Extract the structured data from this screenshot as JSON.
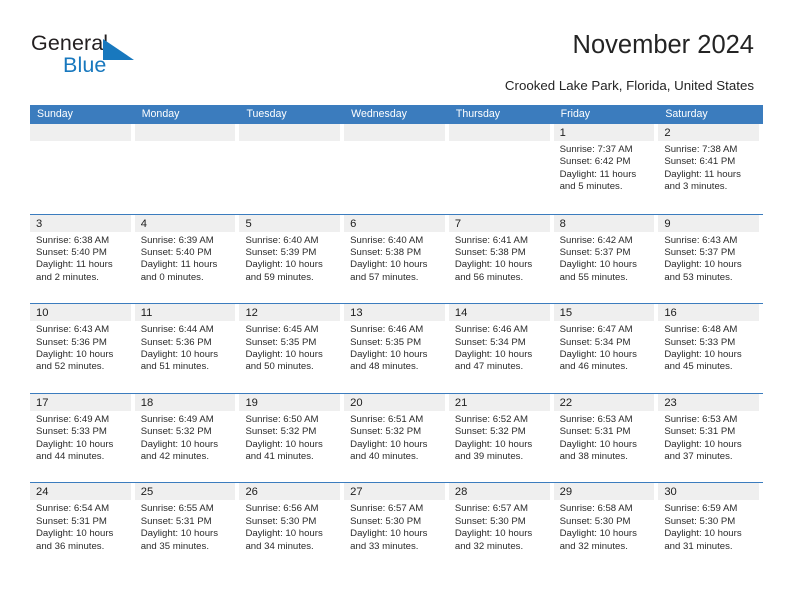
{
  "brand": {
    "name_part1": "General",
    "name_part2": "Blue",
    "accent_color": "#1878be",
    "triangle_icon": "blue-triangle-logo-mark"
  },
  "header": {
    "title": "November 2024",
    "subtitle": "Crooked Lake Park, Florida, United States"
  },
  "calendar": {
    "header_bg": "#3b7cbe",
    "datebar_bg": "#efefef",
    "weekday_headers": [
      "Sunday",
      "Monday",
      "Tuesday",
      "Wednesday",
      "Thursday",
      "Friday",
      "Saturday"
    ],
    "weeks": [
      [
        {
          "day": "",
          "empty": true,
          "lines": []
        },
        {
          "day": "",
          "empty": true,
          "lines": []
        },
        {
          "day": "",
          "empty": true,
          "lines": []
        },
        {
          "day": "",
          "empty": true,
          "lines": []
        },
        {
          "day": "",
          "empty": true,
          "lines": []
        },
        {
          "day": "1",
          "empty": false,
          "lines": [
            "Sunrise: 7:37 AM",
            "Sunset: 6:42 PM",
            "Daylight: 11 hours",
            "and 5 minutes."
          ]
        },
        {
          "day": "2",
          "empty": false,
          "lines": [
            "Sunrise: 7:38 AM",
            "Sunset: 6:41 PM",
            "Daylight: 11 hours",
            "and 3 minutes."
          ]
        }
      ],
      [
        {
          "day": "3",
          "empty": false,
          "lines": [
            "Sunrise: 6:38 AM",
            "Sunset: 5:40 PM",
            "Daylight: 11 hours",
            "and 2 minutes."
          ]
        },
        {
          "day": "4",
          "empty": false,
          "lines": [
            "Sunrise: 6:39 AM",
            "Sunset: 5:40 PM",
            "Daylight: 11 hours",
            "and 0 minutes."
          ]
        },
        {
          "day": "5",
          "empty": false,
          "lines": [
            "Sunrise: 6:40 AM",
            "Sunset: 5:39 PM",
            "Daylight: 10 hours",
            "and 59 minutes."
          ]
        },
        {
          "day": "6",
          "empty": false,
          "lines": [
            "Sunrise: 6:40 AM",
            "Sunset: 5:38 PM",
            "Daylight: 10 hours",
            "and 57 minutes."
          ]
        },
        {
          "day": "7",
          "empty": false,
          "lines": [
            "Sunrise: 6:41 AM",
            "Sunset: 5:38 PM",
            "Daylight: 10 hours",
            "and 56 minutes."
          ]
        },
        {
          "day": "8",
          "empty": false,
          "lines": [
            "Sunrise: 6:42 AM",
            "Sunset: 5:37 PM",
            "Daylight: 10 hours",
            "and 55 minutes."
          ]
        },
        {
          "day": "9",
          "empty": false,
          "lines": [
            "Sunrise: 6:43 AM",
            "Sunset: 5:37 PM",
            "Daylight: 10 hours",
            "and 53 minutes."
          ]
        }
      ],
      [
        {
          "day": "10",
          "empty": false,
          "lines": [
            "Sunrise: 6:43 AM",
            "Sunset: 5:36 PM",
            "Daylight: 10 hours",
            "and 52 minutes."
          ]
        },
        {
          "day": "11",
          "empty": false,
          "lines": [
            "Sunrise: 6:44 AM",
            "Sunset: 5:36 PM",
            "Daylight: 10 hours",
            "and 51 minutes."
          ]
        },
        {
          "day": "12",
          "empty": false,
          "lines": [
            "Sunrise: 6:45 AM",
            "Sunset: 5:35 PM",
            "Daylight: 10 hours",
            "and 50 minutes."
          ]
        },
        {
          "day": "13",
          "empty": false,
          "lines": [
            "Sunrise: 6:46 AM",
            "Sunset: 5:35 PM",
            "Daylight: 10 hours",
            "and 48 minutes."
          ]
        },
        {
          "day": "14",
          "empty": false,
          "lines": [
            "Sunrise: 6:46 AM",
            "Sunset: 5:34 PM",
            "Daylight: 10 hours",
            "and 47 minutes."
          ]
        },
        {
          "day": "15",
          "empty": false,
          "lines": [
            "Sunrise: 6:47 AM",
            "Sunset: 5:34 PM",
            "Daylight: 10 hours",
            "and 46 minutes."
          ]
        },
        {
          "day": "16",
          "empty": false,
          "lines": [
            "Sunrise: 6:48 AM",
            "Sunset: 5:33 PM",
            "Daylight: 10 hours",
            "and 45 minutes."
          ]
        }
      ],
      [
        {
          "day": "17",
          "empty": false,
          "lines": [
            "Sunrise: 6:49 AM",
            "Sunset: 5:33 PM",
            "Daylight: 10 hours",
            "and 44 minutes."
          ]
        },
        {
          "day": "18",
          "empty": false,
          "lines": [
            "Sunrise: 6:49 AM",
            "Sunset: 5:32 PM",
            "Daylight: 10 hours",
            "and 42 minutes."
          ]
        },
        {
          "day": "19",
          "empty": false,
          "lines": [
            "Sunrise: 6:50 AM",
            "Sunset: 5:32 PM",
            "Daylight: 10 hours",
            "and 41 minutes."
          ]
        },
        {
          "day": "20",
          "empty": false,
          "lines": [
            "Sunrise: 6:51 AM",
            "Sunset: 5:32 PM",
            "Daylight: 10 hours",
            "and 40 minutes."
          ]
        },
        {
          "day": "21",
          "empty": false,
          "lines": [
            "Sunrise: 6:52 AM",
            "Sunset: 5:32 PM",
            "Daylight: 10 hours",
            "and 39 minutes."
          ]
        },
        {
          "day": "22",
          "empty": false,
          "lines": [
            "Sunrise: 6:53 AM",
            "Sunset: 5:31 PM",
            "Daylight: 10 hours",
            "and 38 minutes."
          ]
        },
        {
          "day": "23",
          "empty": false,
          "lines": [
            "Sunrise: 6:53 AM",
            "Sunset: 5:31 PM",
            "Daylight: 10 hours",
            "and 37 minutes."
          ]
        }
      ],
      [
        {
          "day": "24",
          "empty": false,
          "lines": [
            "Sunrise: 6:54 AM",
            "Sunset: 5:31 PM",
            "Daylight: 10 hours",
            "and 36 minutes."
          ]
        },
        {
          "day": "25",
          "empty": false,
          "lines": [
            "Sunrise: 6:55 AM",
            "Sunset: 5:31 PM",
            "Daylight: 10 hours",
            "and 35 minutes."
          ]
        },
        {
          "day": "26",
          "empty": false,
          "lines": [
            "Sunrise: 6:56 AM",
            "Sunset: 5:30 PM",
            "Daylight: 10 hours",
            "and 34 minutes."
          ]
        },
        {
          "day": "27",
          "empty": false,
          "lines": [
            "Sunrise: 6:57 AM",
            "Sunset: 5:30 PM",
            "Daylight: 10 hours",
            "and 33 minutes."
          ]
        },
        {
          "day": "28",
          "empty": false,
          "lines": [
            "Sunrise: 6:57 AM",
            "Sunset: 5:30 PM",
            "Daylight: 10 hours",
            "and 32 minutes."
          ]
        },
        {
          "day": "29",
          "empty": false,
          "lines": [
            "Sunrise: 6:58 AM",
            "Sunset: 5:30 PM",
            "Daylight: 10 hours",
            "and 32 minutes."
          ]
        },
        {
          "day": "30",
          "empty": false,
          "lines": [
            "Sunrise: 6:59 AM",
            "Sunset: 5:30 PM",
            "Daylight: 10 hours",
            "and 31 minutes."
          ]
        }
      ]
    ]
  }
}
